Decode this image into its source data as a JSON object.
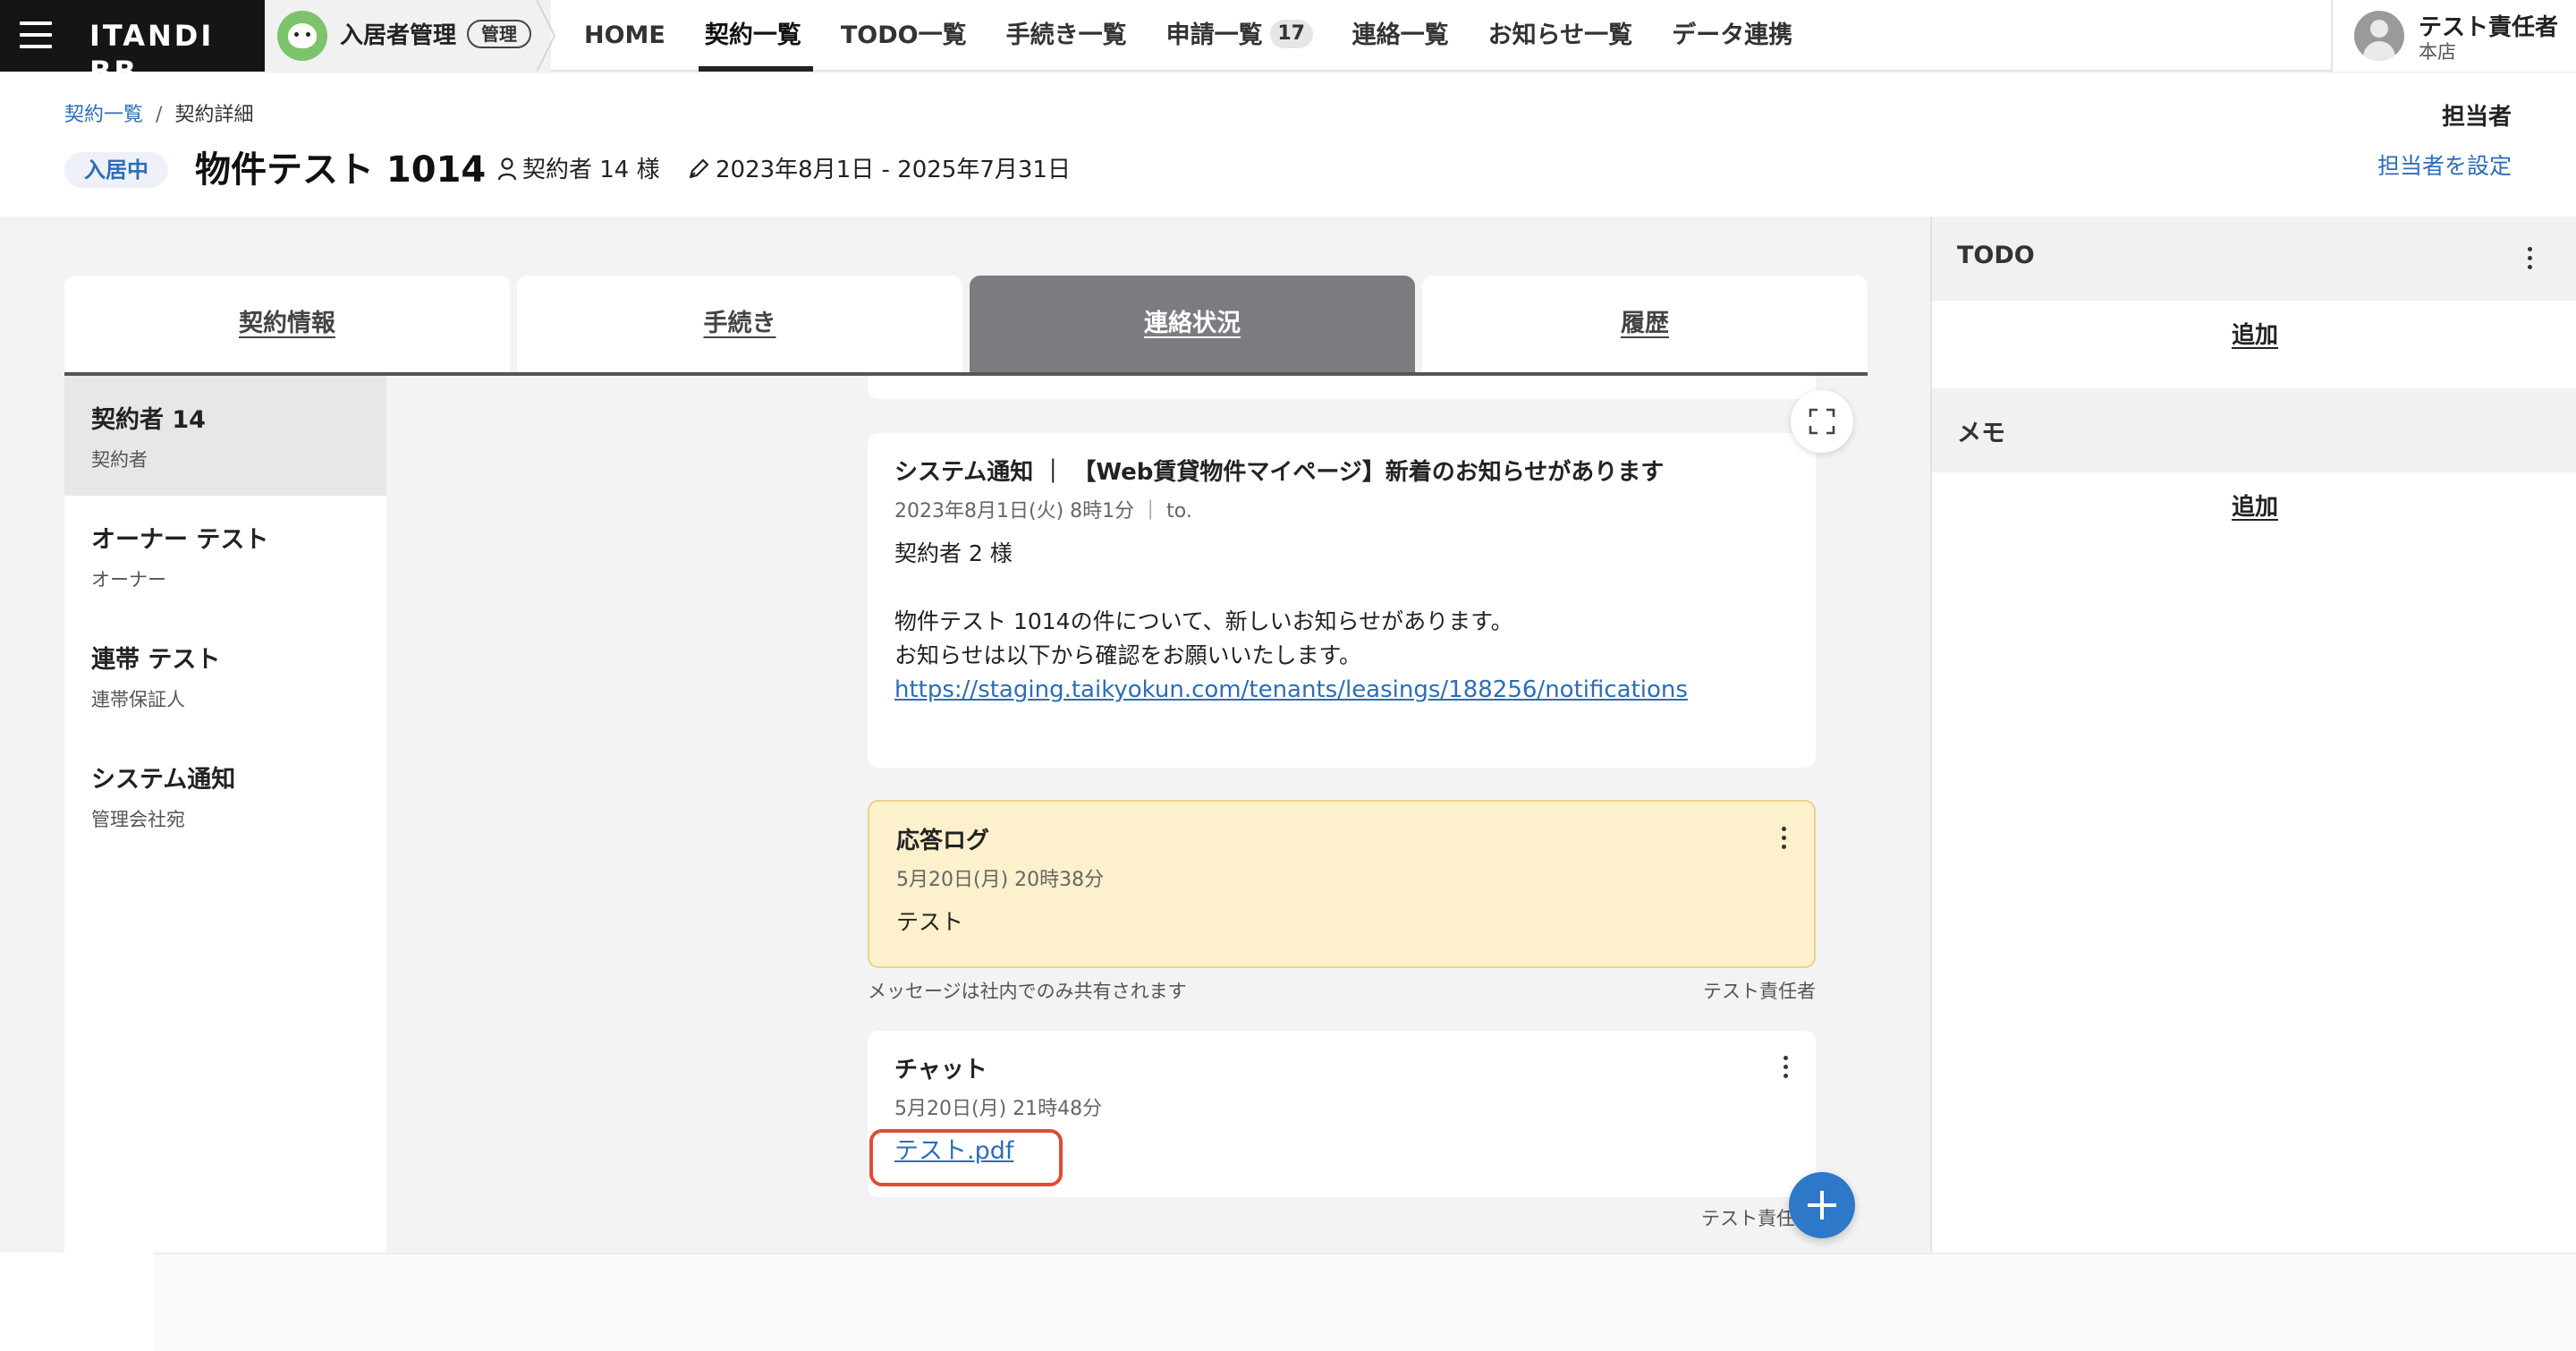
{
  "brand": {
    "logo": "ITANDI BB",
    "menu_icon": "hamburger-menu-icon"
  },
  "product": {
    "name": "入居者管理",
    "badge": "管理",
    "mascot_icon": "bear-mascot-icon"
  },
  "nav": {
    "items": [
      {
        "label": "HOME"
      },
      {
        "label": "契約一覧",
        "active": true
      },
      {
        "label": "TODO一覧"
      },
      {
        "label": "手続き一覧"
      },
      {
        "label": "申請一覧",
        "count": "17"
      },
      {
        "label": "連絡一覧"
      },
      {
        "label": "お知らせ一覧"
      },
      {
        "label": "データ連携"
      }
    ]
  },
  "user": {
    "name": "テスト責任者",
    "store": "本店",
    "avatar_icon": "user-avatar-icon"
  },
  "header": {
    "breadcrumb": {
      "parent": "契約一覧",
      "separator": "/",
      "current": "契約詳細"
    },
    "status": "入居中",
    "title": "物件テスト 1014",
    "contract_holders": "契約者 14 様",
    "period": "2023年8月1日 - 2025年7月31日",
    "assignee_label": "担当者",
    "assignee_link": "担当者を設定"
  },
  "tabs": [
    {
      "label": "契約情報"
    },
    {
      "label": "手続き"
    },
    {
      "label": "連絡状況",
      "active": true
    },
    {
      "label": "履歴"
    }
  ],
  "contacts": [
    {
      "name": "契約者 14",
      "role": "契約者",
      "active": true
    },
    {
      "name": "オーナー テスト",
      "role": "オーナー"
    },
    {
      "name": "連帯 テスト",
      "role": "連帯保証人"
    },
    {
      "name": "システム通知",
      "role": "管理会社宛"
    }
  ],
  "messages": {
    "system": {
      "title": "システム通知 ｜ 【Web賃貸物件マイページ】新着のお知らせがあります",
      "time": "2023年8月1日(火) 8時1分 ｜ to.",
      "body": "契約者 2 様\n\n物件テスト 1014の件について、新しいお知らせがあります。\nお知らせは以下から確認をお願いいたします。\n",
      "link": "https://staging.taikyokun.com/tenants/leasings/188256/notifications"
    },
    "log": {
      "title": "応答ログ",
      "time": "5月20日(月) 20時38分",
      "body": "テスト",
      "footer_note": "メッセージは社内でのみ共有されます",
      "footer_author": "テスト責任者"
    },
    "chat": {
      "title": "チャット",
      "time": "5月20日(月) 21時48分",
      "file": "テスト.pdf",
      "footer_author": "テスト責任"
    }
  },
  "right_panel": {
    "todo": {
      "title": "TODO",
      "add": "追加"
    },
    "memo": {
      "title": "メモ",
      "add": "追加"
    }
  },
  "colors": {
    "accent": "#2d6db6",
    "active_tab": "#7b7b80",
    "log_bg": "#fcf0cd",
    "highlight": "#e04b34",
    "fab": "#2d78c8"
  }
}
